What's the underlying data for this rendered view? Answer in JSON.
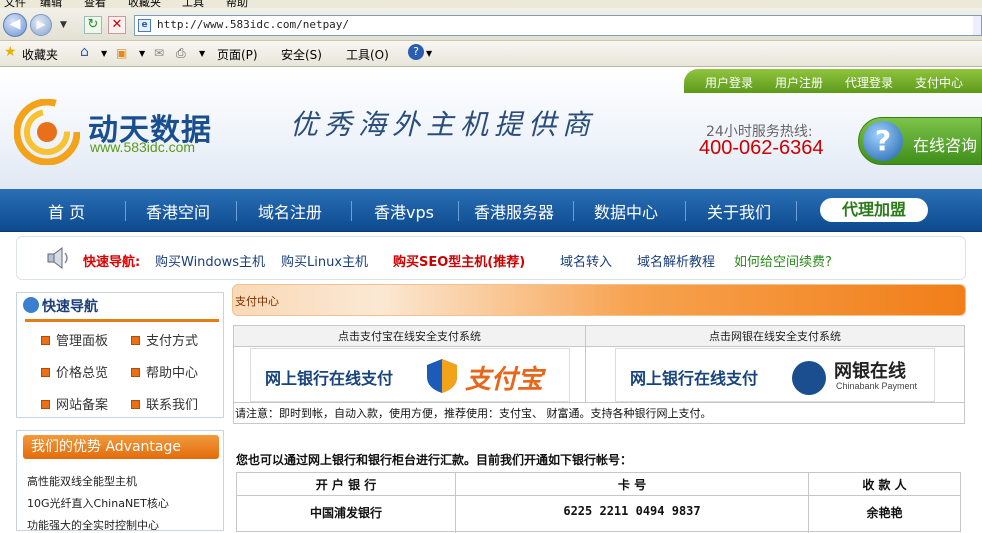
{
  "browser": {
    "menu_items": [
      "文件",
      "编辑",
      "查看",
      "收藏夹",
      "工具",
      "帮助"
    ],
    "url": "http://www.583idc.com/netpay/",
    "favorites_label": "收藏夹",
    "page_menu": "页面(P)",
    "safety_menu": "安全(S)",
    "tools_menu": "工具(O)"
  },
  "header": {
    "top_links": [
      "用户登录",
      "用户注册",
      "代理登录",
      "支付中心"
    ],
    "logo_text": "动天数据",
    "logo_url": "www.583idc.com",
    "slogan": "优秀海外主机提供商",
    "hotline_label": "24小时服务热线:",
    "hotline": "400-062-6364",
    "consult_label": "在线咨询"
  },
  "nav": {
    "items": [
      "首 页",
      "香港空间",
      "域名注册",
      "香港vps",
      "香港服务器",
      "数据中心",
      "关于我们"
    ],
    "join_label": "代理加盟"
  },
  "quicknav": {
    "lead": "快速导航:",
    "links": [
      "购买Windows主机",
      "购买Linux主机",
      "购买SEO型主机(推荐)",
      "域名转入",
      "域名解析教程",
      "如何给空间续费?"
    ]
  },
  "sidebar": {
    "quick_title": "快速导航",
    "quick_items": [
      "管理面板",
      "支付方式",
      "价格总览",
      "帮助中心",
      "网站备案",
      "联系我们"
    ],
    "advantage_title": "我们的优势 Advantage",
    "advantages": [
      "高性能双线全能型主机",
      "10G光纤直入ChinaNET核心",
      "功能强大的全实时控制中心"
    ]
  },
  "main": {
    "pay_center": "支付中心",
    "alipay_header": "点击支付宝在线安全支付系统",
    "chinabank_header": "点击网银在线安全支付系统",
    "online_bank_pay": "网上银行在线支付",
    "alipay_word": "支付宝",
    "chinabank_word": "网银在线",
    "chinabank_sub": "Chinabank Payment",
    "note": "请注意：即时到帐，自动入款，使用方便，推荐使用：支付宝、 财富通。支持各种银行网上支付。",
    "transfer_note": "您也可以通过网上银行和银行柜台进行汇款。目前我们开通如下银行帐号：",
    "bank_headers": [
      "开 户 银 行",
      "卡 号",
      "收 款 人"
    ],
    "bank_rows": [
      [
        "中国浦发银行",
        "6225 2211 0494 9837",
        "余艳艳"
      ]
    ]
  }
}
